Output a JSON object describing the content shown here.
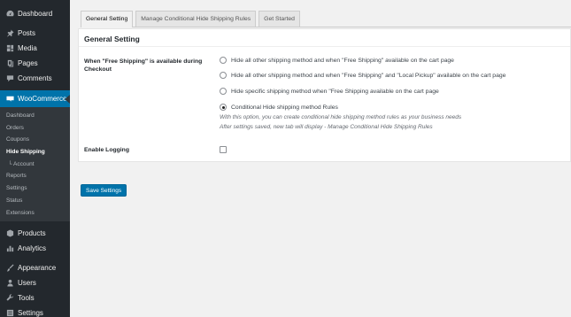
{
  "sidebar": {
    "dashboard": "Dashboard",
    "posts": "Posts",
    "media": "Media",
    "pages": "Pages",
    "comments": "Comments",
    "woocommerce": "WooCommerce",
    "submenu": [
      "Dashboard",
      "Orders",
      "Coupons",
      "Hide Shipping",
      "└ Account",
      "Reports",
      "Settings",
      "Status",
      "Extensions"
    ],
    "products": "Products",
    "analytics": "Analytics",
    "appearance": "Appearance",
    "users": "Users",
    "tools": "Tools",
    "settings": "Settings"
  },
  "tabs": [
    "General Setting",
    "Manage Conditional Hide Shipping Rules",
    "Get Started"
  ],
  "panel": {
    "title": "General Setting",
    "free_shipping_label": "When \"Free Shipping\" is available during Checkout",
    "options": [
      "Hide all other shipping method and when \"Free Shipping\" available on the cart page",
      "Hide all other shipping method and when \"Free Shipping\" and \"Local Pickup\" available on the cart page",
      "Hide specific shipping method when \"Free Shipping available on the cart page",
      "Conditional Hide shipping method Rules"
    ],
    "selected_option": 3,
    "description_1": "With this option, you can create conditional hide shipping method rules as your business needs",
    "description_2": "After settings saved, new tab will display - Manage Conditional Hide Shipping Rules",
    "logging_label": "Enable Logging"
  },
  "save_button": "Save Settings"
}
